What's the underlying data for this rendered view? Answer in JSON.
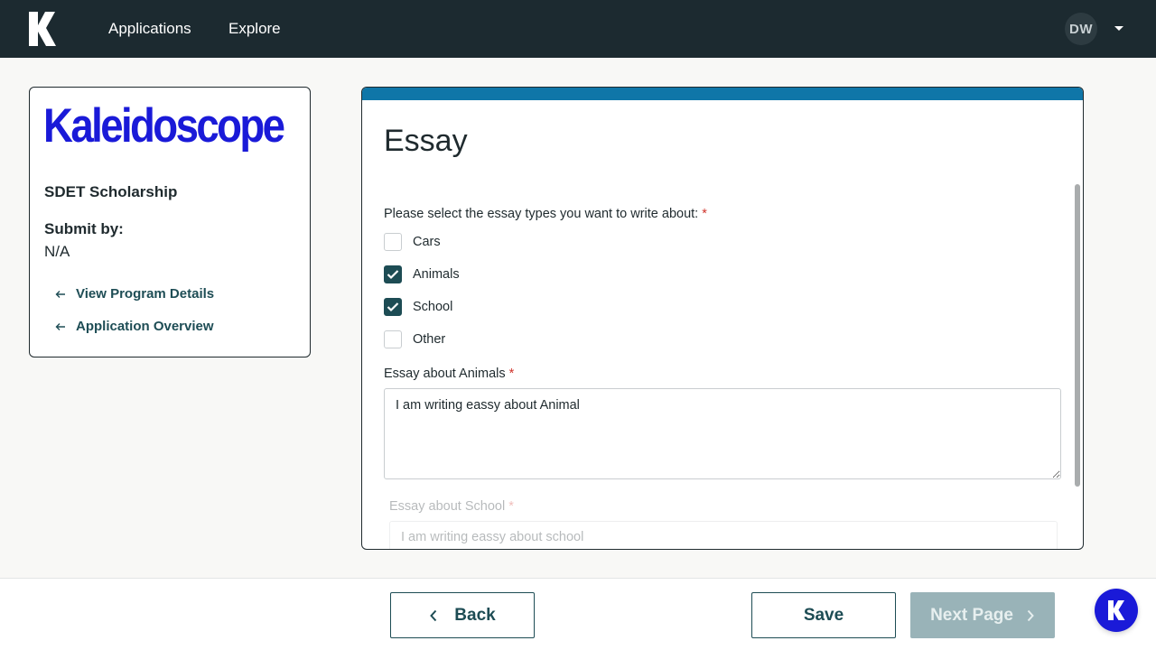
{
  "nav": {
    "logo_icon": "k-logo-icon",
    "items": [
      {
        "label": "Applications"
      },
      {
        "label": "Explore"
      }
    ],
    "avatar_initials": "DW",
    "menu_icon": "caret-down-icon"
  },
  "program": {
    "brand": "Kaleidoscope",
    "brand_color": "#1a1ad8",
    "name": "SDET Scholarship",
    "submit_label": "Submit by:",
    "submit_value": "N/A",
    "links": [
      {
        "label": "View Program Details",
        "icon": "arrow-left-icon"
      },
      {
        "label": "Application Overview",
        "icon": "arrow-left-icon"
      }
    ]
  },
  "essay": {
    "accent_color": "#0f76a8",
    "title": "Essay",
    "question": "Please select the essay types you want to write about:",
    "required_mark": "*",
    "options": [
      {
        "label": "Cars",
        "checked": false
      },
      {
        "label": "Animals",
        "checked": true
      },
      {
        "label": "School",
        "checked": true
      },
      {
        "label": "Other",
        "checked": false
      }
    ],
    "animals_label": "Essay about Animals",
    "animals_value": "I am writing eassy about Animal",
    "school_label": "Essay about School",
    "school_value": "I am writing eassy about school"
  },
  "footer": {
    "back_label": "Back",
    "save_label": "Save",
    "next_label": "Next Page",
    "primary_color": "#1d4c54"
  },
  "chat": {
    "icon": "k-chat-icon",
    "color": "#1a1ad8"
  }
}
